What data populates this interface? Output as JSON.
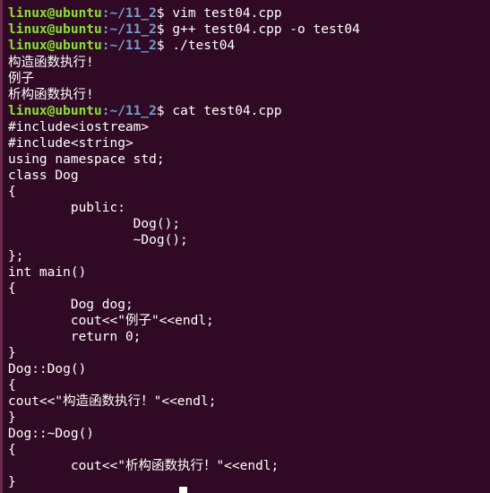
{
  "colors": {
    "background": "#300a24",
    "user": "#8ae234",
    "path": "#729fcf",
    "text": "#ffffff"
  },
  "prompt": {
    "user_host": "linux@ubuntu",
    "separator": ":",
    "path": "~/11_2",
    "symbol": "$ "
  },
  "commands": [
    "vim test04.cpp",
    "g++ test04.cpp -o test04",
    "./test04",
    "cat test04.cpp"
  ],
  "program_output": [
    "构造函数执行!",
    "例子",
    "析构函数执行!"
  ],
  "file_lines": [
    "#include<iostream>",
    "#include<string>",
    "using namespace std;",
    "class Dog",
    "{",
    "        public:",
    "                Dog();",
    "                ~Dog();",
    "};",
    "int main()",
    "{",
    "        Dog dog;",
    "        cout<<\"例子\"<<endl;",
    "        return 0;",
    "}",
    "Dog::Dog()",
    "{",
    "cout<<\"构造函数执行！\"<<endl;",
    "}",
    "Dog::~Dog()",
    "{",
    "        cout<<\"析构函数执行！\"<<endl;",
    "}"
  ]
}
